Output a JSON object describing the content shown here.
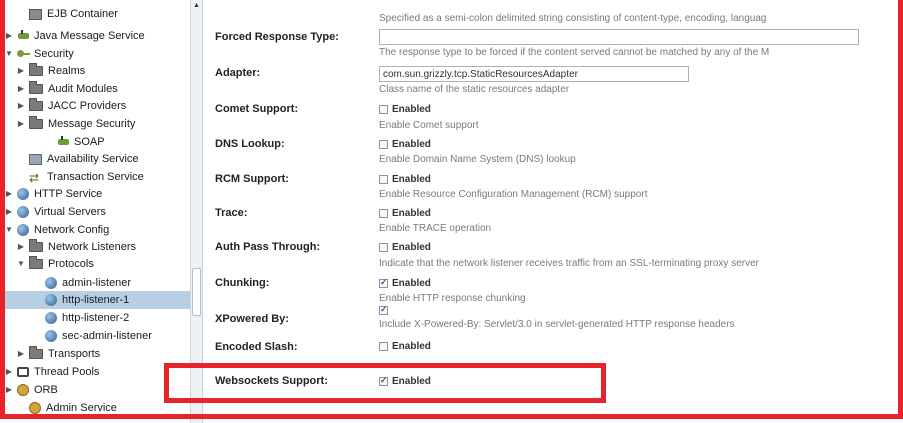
{
  "sidebar": {
    "items": [
      {
        "label": "EJB Container",
        "icon": "ejb-container-icon",
        "expander": "none",
        "selected": false
      },
      {
        "label": "Java Message Service",
        "icon": "plug-icon",
        "expander": "collapsed",
        "selected": false
      },
      {
        "label": "Security",
        "icon": "key-icon",
        "expander": "expanded",
        "selected": false
      },
      {
        "label": "Realms",
        "icon": "folder-icon",
        "expander": "collapsed",
        "selected": false
      },
      {
        "label": "Audit Modules",
        "icon": "folder-icon",
        "expander": "collapsed",
        "selected": false
      },
      {
        "label": "JACC Providers",
        "icon": "folder-icon",
        "expander": "collapsed",
        "selected": false
      },
      {
        "label": "Message Security",
        "icon": "folder-icon",
        "expander": "collapsed",
        "selected": false
      },
      {
        "label": "SOAP",
        "icon": "plug-icon",
        "expander": "none",
        "selected": false
      },
      {
        "label": "Availability Service",
        "icon": "availability-icon",
        "expander": "none",
        "selected": false
      },
      {
        "label": "Transaction Service",
        "icon": "transaction-icon",
        "expander": "none",
        "selected": false
      },
      {
        "label": "HTTP Service",
        "icon": "globe-icon",
        "expander": "collapsed",
        "selected": false
      },
      {
        "label": "Virtual Servers",
        "icon": "globe-icon",
        "expander": "collapsed",
        "selected": false
      },
      {
        "label": "Network Config",
        "icon": "globe-icon",
        "expander": "expanded",
        "selected": false
      },
      {
        "label": "Network Listeners",
        "icon": "folder-icon",
        "expander": "collapsed",
        "selected": false
      },
      {
        "label": "Protocols",
        "icon": "folder-icon",
        "expander": "expanded",
        "selected": false
      },
      {
        "label": "admin-listener",
        "icon": "globe-icon",
        "expander": "none",
        "selected": false
      },
      {
        "label": "http-listener-1",
        "icon": "globe-icon",
        "expander": "none",
        "selected": true
      },
      {
        "label": "http-listener-2",
        "icon": "globe-icon",
        "expander": "none",
        "selected": false
      },
      {
        "label": "sec-admin-listener",
        "icon": "globe-icon",
        "expander": "none",
        "selected": false
      },
      {
        "label": "Transports",
        "icon": "folder-icon",
        "expander": "collapsed",
        "selected": false
      },
      {
        "label": "Thread Pools",
        "icon": "thread-pool-icon",
        "expander": "collapsed",
        "selected": false
      },
      {
        "label": "ORB",
        "icon": "orb-icon",
        "expander": "collapsed",
        "selected": false
      },
      {
        "label": "Admin Service",
        "icon": "admin-service-icon",
        "expander": "none",
        "selected": false
      }
    ]
  },
  "form": {
    "top_help": "Specified as a semi-colon delimited string consisting of content-type, encoding, languag",
    "forced_response": {
      "label": "Forced Response Type:",
      "value": "",
      "help": "The response type to be forced if the content served cannot be matched by any of the M"
    },
    "adapter": {
      "label": "Adapter:",
      "value": "com.sun.grizzly.tcp.StaticResourcesAdapter",
      "help": "Class name of the static resources adapter"
    },
    "comet": {
      "label": "Comet Support:",
      "checkbox_label": "Enabled",
      "checked": false,
      "help": "Enable Comet support"
    },
    "dns": {
      "label": "DNS Lookup:",
      "checkbox_label": "Enabled",
      "checked": false,
      "help": "Enable Domain Name System (DNS) lookup"
    },
    "rcm": {
      "label": "RCM Support:",
      "checkbox_label": "Enabled",
      "checked": false,
      "help": "Enable Resource Configuration Management (RCM) support"
    },
    "trace": {
      "label": "Trace:",
      "checkbox_label": "Enabled",
      "checked": false,
      "help": "Enable TRACE operation"
    },
    "auth_pass": {
      "label": "Auth Pass Through:",
      "checkbox_label": "Enabled",
      "checked": false,
      "help": "Indicate that the network listener receives traffic from an SSL-terminating proxy server"
    },
    "chunking": {
      "label": "Chunking:",
      "checkbox_label": "Enabled",
      "checked": true,
      "help": "Enable HTTP response chunking"
    },
    "xpowered": {
      "label": "XPowered By:",
      "checked": true,
      "help": "Include X-Powered-By: Servlet/3.0 in servlet-generated HTTP response headers"
    },
    "encoded_slash": {
      "label": "Encoded Slash:",
      "checkbox_label": "Enabled",
      "checked": false
    },
    "websockets": {
      "label": "Websockets Support:",
      "checkbox_label": "Enabled",
      "checked": true
    }
  },
  "colors": {
    "annotation_red": "#e8232b",
    "selection_blue": "#b8cfe3"
  }
}
